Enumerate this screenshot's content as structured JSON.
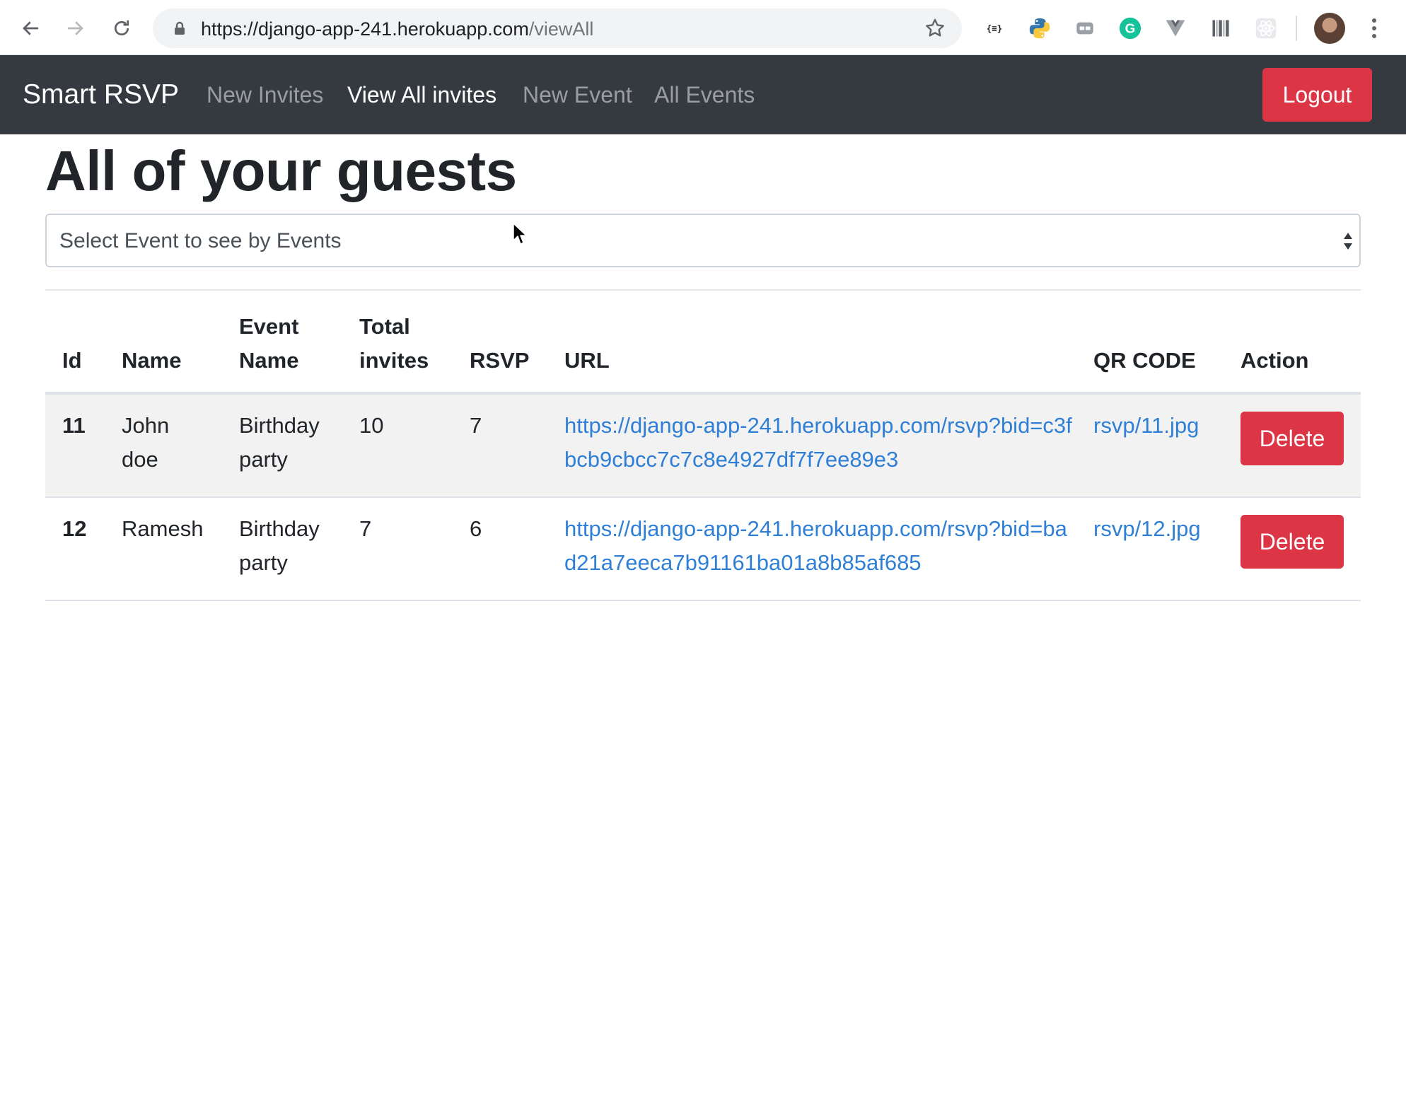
{
  "browser": {
    "url_host": "https://django-app-241.herokuapp.com",
    "url_path": "/viewAll",
    "extensions": [
      "json-viewer-icon",
      "python-icon",
      "media-icon",
      "grammarly-icon",
      "vue-devtools-icon",
      "barcode-icon",
      "react-devtools-icon"
    ]
  },
  "navbar": {
    "brand": "Smart RSVP",
    "links": [
      {
        "label": "New Invites",
        "active": false
      },
      {
        "label": "View All invites",
        "active": true
      },
      {
        "label": "New Event",
        "active": false
      },
      {
        "label": "All Events",
        "active": false
      }
    ],
    "logout_label": "Logout"
  },
  "main": {
    "title": "All of your guests",
    "select_placeholder": "Select Event to see by Events",
    "table": {
      "headers": [
        "Id",
        "Name",
        "Event Name",
        "Total invites",
        "RSVP",
        "URL",
        "QR CODE",
        "Action"
      ],
      "rows": [
        {
          "id": "11",
          "name": "John doe",
          "event": "Birthday party",
          "total": "10",
          "rsvp": "7",
          "url": "https://django-app-241.herokuapp.com/rsvp?bid=c3fbcb9cbcc7c7c8e4927df7f7ee89e3",
          "qr": "rsvp/11.jpg",
          "action": "Delete"
        },
        {
          "id": "12",
          "name": "Ramesh",
          "event": "Birthday party",
          "total": "7",
          "rsvp": "6",
          "url": "https://django-app-241.herokuapp.com/rsvp?bid=bad21a7eeca7b91161ba01a8b85af685",
          "qr": "rsvp/12.jpg",
          "action": "Delete"
        }
      ]
    }
  },
  "colors": {
    "navbar_bg": "#343a40",
    "danger": "#dc3545",
    "link": "#2f7fd6"
  }
}
